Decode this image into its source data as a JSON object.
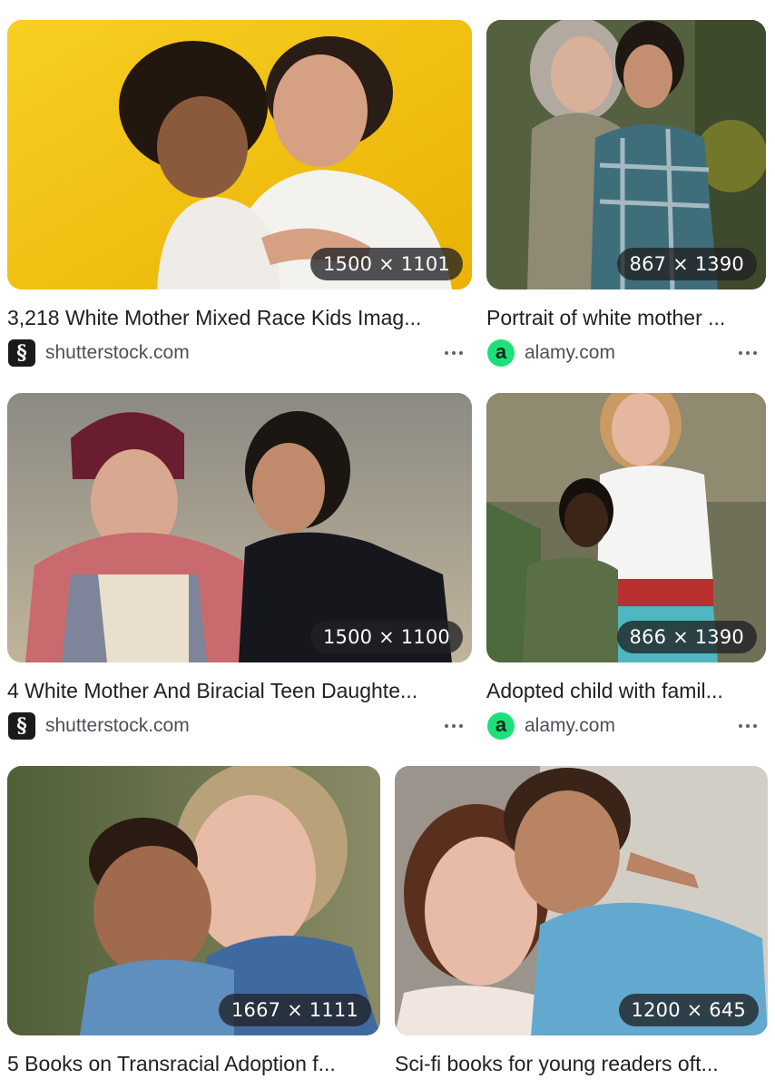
{
  "results": [
    {
      "title": "3,218 White Mother Mixed Race Kids Imag...",
      "dimensions": "1500 × 1101",
      "source": "shutterstock.com",
      "source_icon": "shutterstock-logo",
      "source_icon_glyph": "§",
      "bg_color": "#f2c20f"
    },
    {
      "title": "Portrait of white mother ...",
      "dimensions": "867 × 1390",
      "source": "alamy.com",
      "source_icon": "alamy-logo",
      "source_icon_glyph": "a",
      "bg_color": "#4f5a3a"
    },
    {
      "title": "4 White Mother And Biracial Teen Daughte...",
      "dimensions": "1500 × 1100",
      "source": "shutterstock.com",
      "source_icon": "shutterstock-logo",
      "source_icon_glyph": "§",
      "bg_color": "#a9a08e"
    },
    {
      "title": "Adopted child with famil...",
      "dimensions": "866 × 1390",
      "source": "alamy.com",
      "source_icon": "alamy-logo",
      "source_icon_glyph": "a",
      "bg_color": "#6b6a54"
    },
    {
      "title": "5 Books on Transracial Adoption f...",
      "dimensions": "1667 × 1111",
      "bg_color": "#6f7a4f"
    },
    {
      "title": "Sci-fi books for young readers oft...",
      "dimensions": "1200 × 645",
      "bg_color": "#c9c5be"
    }
  ]
}
